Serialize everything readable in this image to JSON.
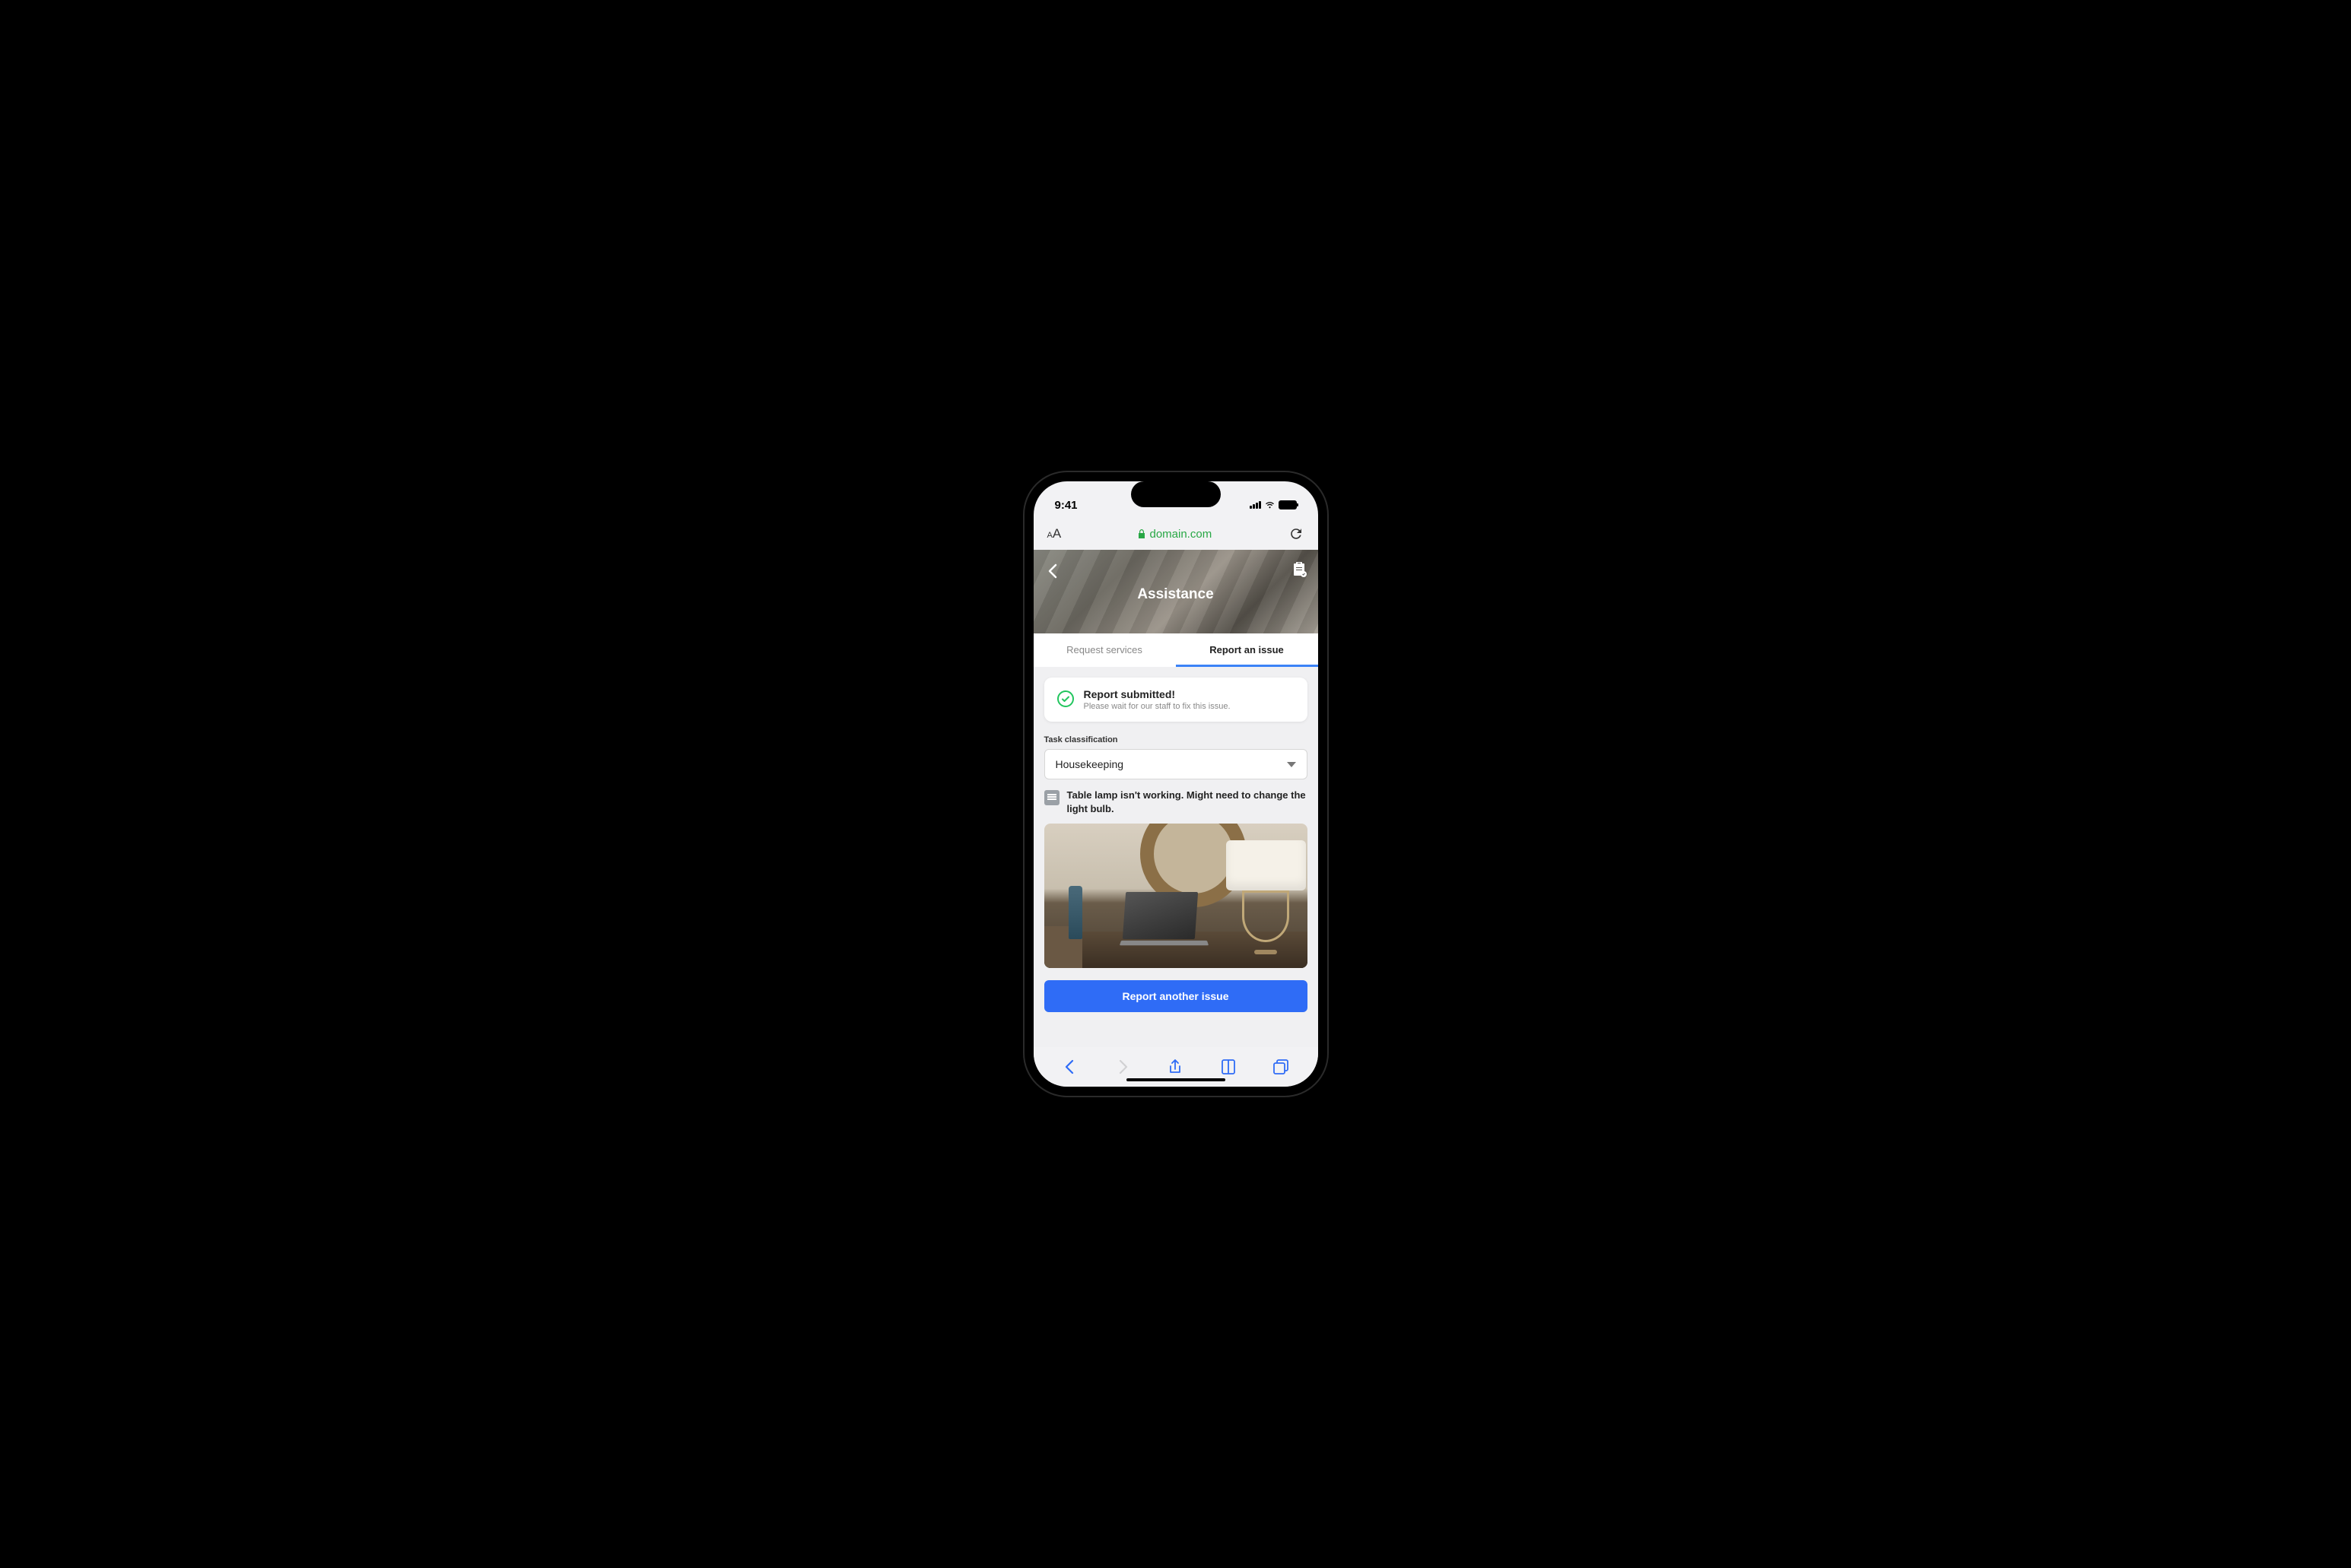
{
  "status_bar": {
    "time": "9:41"
  },
  "browser": {
    "url": "domain.com"
  },
  "hero": {
    "title": "Assistance"
  },
  "tabs": {
    "request": "Request services",
    "report": "Report an issue"
  },
  "success": {
    "title": "Report submitted!",
    "subtitle": "Please wait for our staff to fix this issue."
  },
  "form": {
    "classification_label": "Task classification",
    "classification_value": "Housekeeping",
    "issue_text": "Table lamp isn't working. Might need to change the light bulb."
  },
  "cta": {
    "report_another": "Report another issue"
  }
}
